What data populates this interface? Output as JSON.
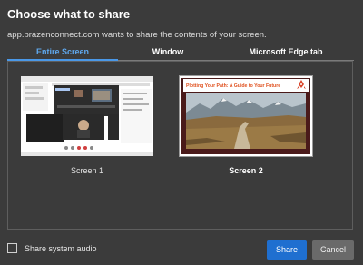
{
  "dialog": {
    "title": "Choose what to share",
    "subtitle": "app.brazenconnect.com wants to share the contents of your screen."
  },
  "tabs": [
    {
      "label": "Entire Screen",
      "active": true
    },
    {
      "label": "Window",
      "active": false
    },
    {
      "label": "Microsoft Edge tab",
      "active": false
    }
  ],
  "screens": [
    {
      "label": "Screen 1",
      "selected": false
    },
    {
      "label": "Screen 2",
      "selected": true,
      "slide_title": "Plotting Your Path: A Guide to Your Future"
    }
  ],
  "footer": {
    "checkbox_label": "Share system audio",
    "checkbox_checked": false,
    "share_label": "Share",
    "cancel_label": "Cancel"
  },
  "colors": {
    "background": "#3b3b3b",
    "accent": "#4a98e8",
    "share_button": "#1f6fd0",
    "cancel_button": "#6a6a6a",
    "slide_title": "#e0511f"
  }
}
